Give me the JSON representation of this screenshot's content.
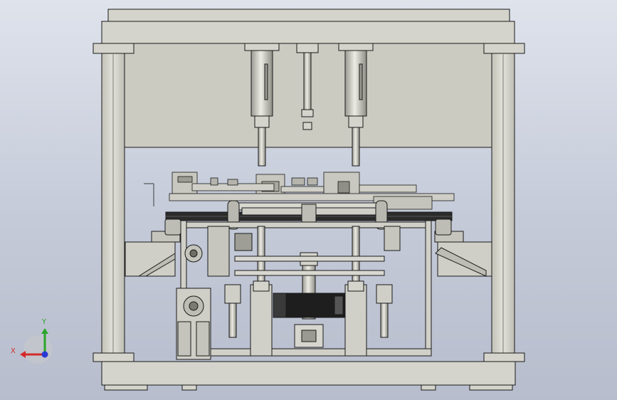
{
  "viewport": {
    "background_top": "#dfe3ec",
    "background_bottom": "#b7bdcc"
  },
  "model": {
    "frame_color": "#d4d4cc",
    "panel_color": "#c9c9c0",
    "line_color": "#1a1a1a",
    "belt_color": "#2b2b2b",
    "motor_color": "#1e1e1e"
  },
  "triad": {
    "x_label": "X",
    "y_label": "Y",
    "x_color": "#d42a2a",
    "y_color": "#2aa52a",
    "z_color": "#2a3ad4"
  }
}
